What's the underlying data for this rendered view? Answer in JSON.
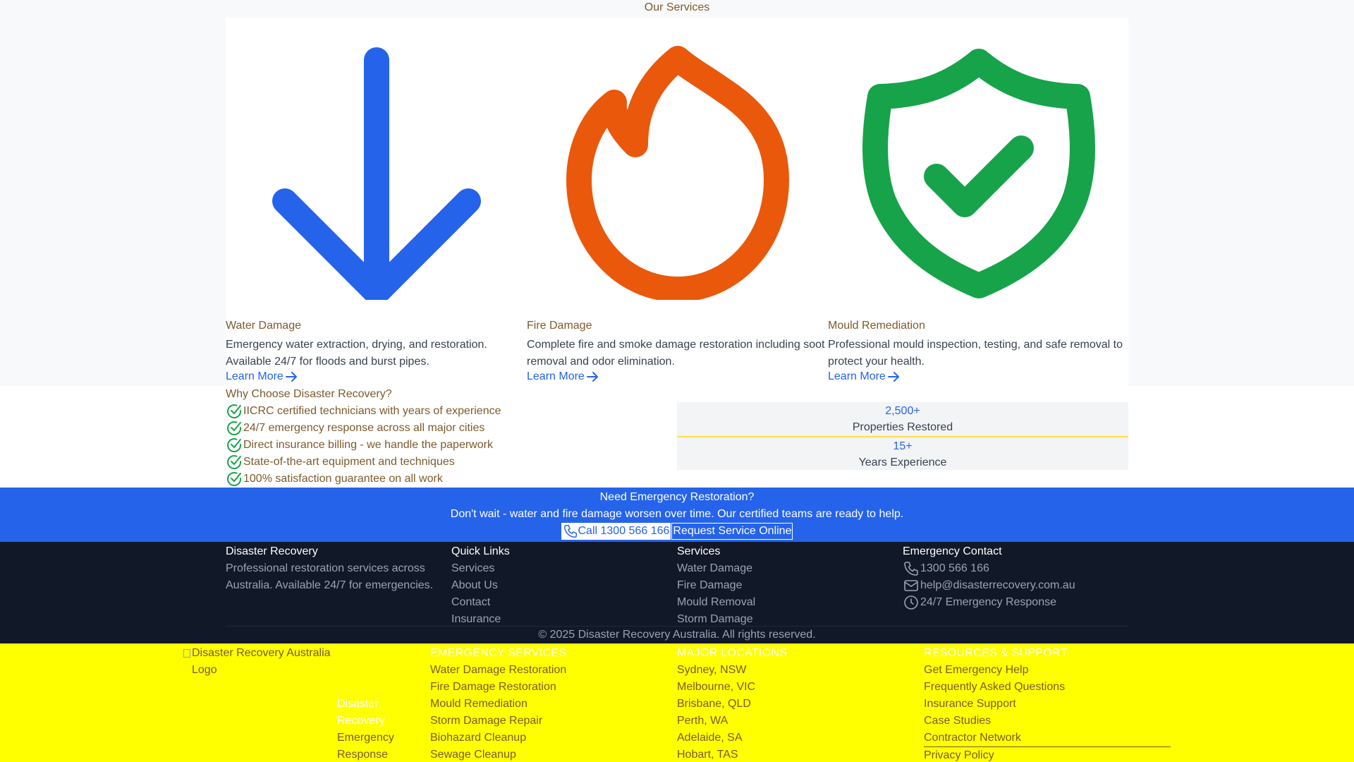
{
  "services": {
    "title": "Our Services",
    "items": [
      {
        "icon": "arrow-down-icon",
        "color": "#2563eb",
        "name": "Water Damage",
        "desc_line1": "Emergency water extraction, drying, and restoration.",
        "desc_line2": "Available 24/7 for floods and burst pipes.",
        "link": "Learn More"
      },
      {
        "icon": "flame-icon",
        "color": "#ea580c",
        "name": "Fire Damage",
        "desc_line1": "Complete fire and smoke damage restoration including soot",
        "desc_line2": "removal and odor elimination.",
        "link": "Learn More"
      },
      {
        "icon": "shield-check-icon",
        "color": "#16a34a",
        "name": "Mould Remediation",
        "desc_line1": "Professional mould inspection, testing, and safe removal to",
        "desc_line2": "protect your health.",
        "link": "Learn More"
      }
    ]
  },
  "why": {
    "title": "Why Choose Disaster Recovery?",
    "items": [
      "IICRC certified technicians with years of experience",
      "24/7 emergency response across all major cities",
      "Direct insurance billing - we handle the paperwork",
      "State-of-the-art equipment and techniques",
      "100% satisfaction guarantee on all work"
    ]
  },
  "stats": [
    {
      "number": "2,500+",
      "label": "Properties Restored"
    },
    {
      "number": "15+",
      "label": "Years Experience"
    }
  ],
  "cta": {
    "title": "Need Emergency Restoration?",
    "text": "Don't wait - water and fire damage worsen over time. Our certified teams are ready to help.",
    "call_label": "Call 1300 566 166",
    "request_label": "Request Service Online"
  },
  "footer": {
    "brand_title": "Disaster Recovery",
    "brand_line1": "Professional restoration services across",
    "brand_line2": "Australia. Available 24/7 for emergencies.",
    "quick_links_title": "Quick Links",
    "quick_links": [
      "Services",
      "About Us",
      "Contact",
      "Insurance"
    ],
    "services_title": "Services",
    "services": [
      "Water Damage",
      "Fire Damage",
      "Mould Removal",
      "Storm Damage"
    ],
    "contact_title": "Emergency Contact",
    "phone": "1300 566 166",
    "email": "help@disasterrecovery.com.au",
    "hours": "24/7 Emergency Response",
    "copyright": "© 2025 Disaster Recovery Australia. All rights reserved."
  },
  "yfooter": {
    "logo_alt_line1": "Disaster Recovery Australia",
    "logo_alt_line2": "Logo",
    "brand_title": "Disaster Recovery",
    "brand_line1": "Emergency",
    "brand_line2": "Response",
    "emergency_title": "Emergency Services",
    "emergency": [
      "Water Damage Restoration",
      "Fire Damage Restoration",
      "Mould Remediation",
      "Storm Damage Repair",
      "Biohazard Cleanup",
      "Sewage Cleanup"
    ],
    "locations_title": "Major Locations",
    "locations": [
      "Sydney, NSW",
      "Melbourne, VIC",
      "Brisbane, QLD",
      "Perth, WA",
      "Adelaide, SA",
      "Hobart, TAS"
    ],
    "resources_title": "Resources & Support",
    "resources": [
      "Get Emergency Help",
      "Frequently Asked Questions",
      "Insurance Support",
      "Case Studies",
      "Contractor Network",
      "Privacy Policy"
    ]
  },
  "colors": {
    "accent": "#2563eb",
    "dark": "#111827",
    "highlight": "#ffff00",
    "text_brown": "#7c5a2c"
  }
}
